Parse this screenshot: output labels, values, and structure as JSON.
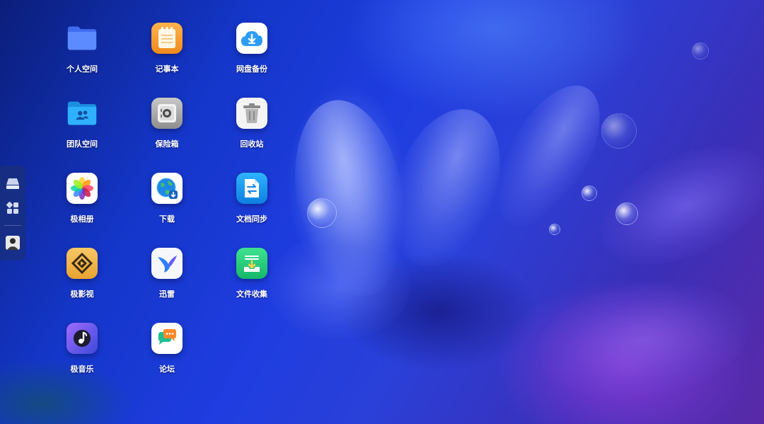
{
  "dock": {
    "items": [
      {
        "icon": "drive-icon"
      },
      {
        "icon": "app-grid-icon"
      },
      {
        "icon": "avatar"
      }
    ]
  },
  "apps": [
    {
      "label": "个人空间",
      "icon": "folder-icon"
    },
    {
      "label": "记事本",
      "icon": "notepad-icon"
    },
    {
      "label": "网盘备份",
      "icon": "cloud-download-icon"
    },
    {
      "label": "团队空间",
      "icon": "team-folder-icon"
    },
    {
      "label": "保险箱",
      "icon": "safe-icon"
    },
    {
      "label": "回收站",
      "icon": "trash-icon"
    },
    {
      "label": "极相册",
      "icon": "photos-icon"
    },
    {
      "label": "下载",
      "icon": "globe-download-icon"
    },
    {
      "label": "文档同步",
      "icon": "sync-icon"
    },
    {
      "label": "极影视",
      "icon": "video-icon"
    },
    {
      "label": "迅雷",
      "icon": "thunder-icon"
    },
    {
      "label": "文件收集",
      "icon": "file-collect-icon"
    },
    {
      "label": "极音乐",
      "icon": "music-icon"
    },
    {
      "label": "论坛",
      "icon": "forum-icon"
    }
  ]
}
